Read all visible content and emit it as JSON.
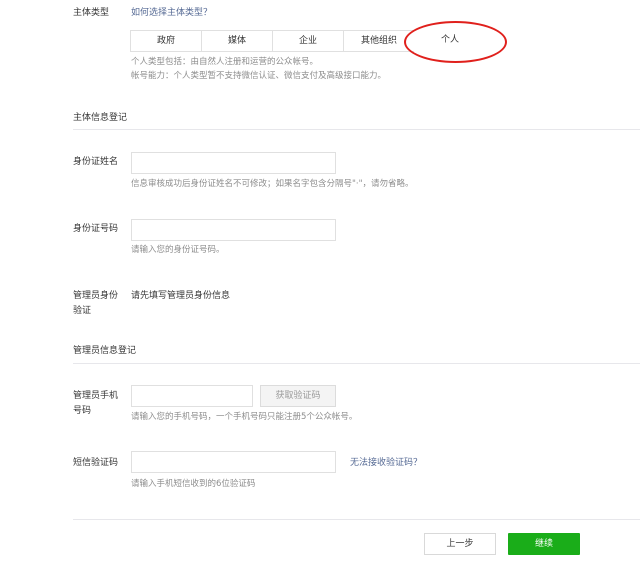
{
  "subject_type": {
    "label": "主体类型",
    "help_link": "如何选择主体类型？",
    "options": [
      "政府",
      "媒体",
      "企业",
      "其他组织",
      "个人"
    ],
    "selected": "个人",
    "tip_line1": "个人类型包括：由自然人注册和运营的公众帐号。",
    "tip_line2": "帐号能力：个人类型暂不支持微信认证、微信支付及高级接口能力。"
  },
  "subject_info": {
    "section_title": "主体信息登记",
    "id_name_label": "身份证姓名",
    "id_name_tip": "信息审核成功后身份证姓名不可修改；如果名字包含分隔号\"·\"，请勿省略。",
    "id_number_label": "身份证号码",
    "id_number_tip": "请输入您的身份证号码。",
    "admin_verify_label_line1": "管理员身份",
    "admin_verify_label_line2": "验证",
    "admin_verify_text": "请先填写管理员身份信息"
  },
  "admin_info": {
    "section_title": "管理员信息登记",
    "phone_label_line1": "管理员手机",
    "phone_label_line2": "号码",
    "get_code_button": "获取验证码",
    "phone_tip": "请输入您的手机号码，一个手机号码只能注册5个公众帐号。",
    "sms_label": "短信验证码",
    "sms_help_link": "无法接收验证码？",
    "sms_tip": "请输入手机短信收到的6位验证码"
  },
  "footer": {
    "prev_button": "上一步",
    "next_button": "继续"
  }
}
